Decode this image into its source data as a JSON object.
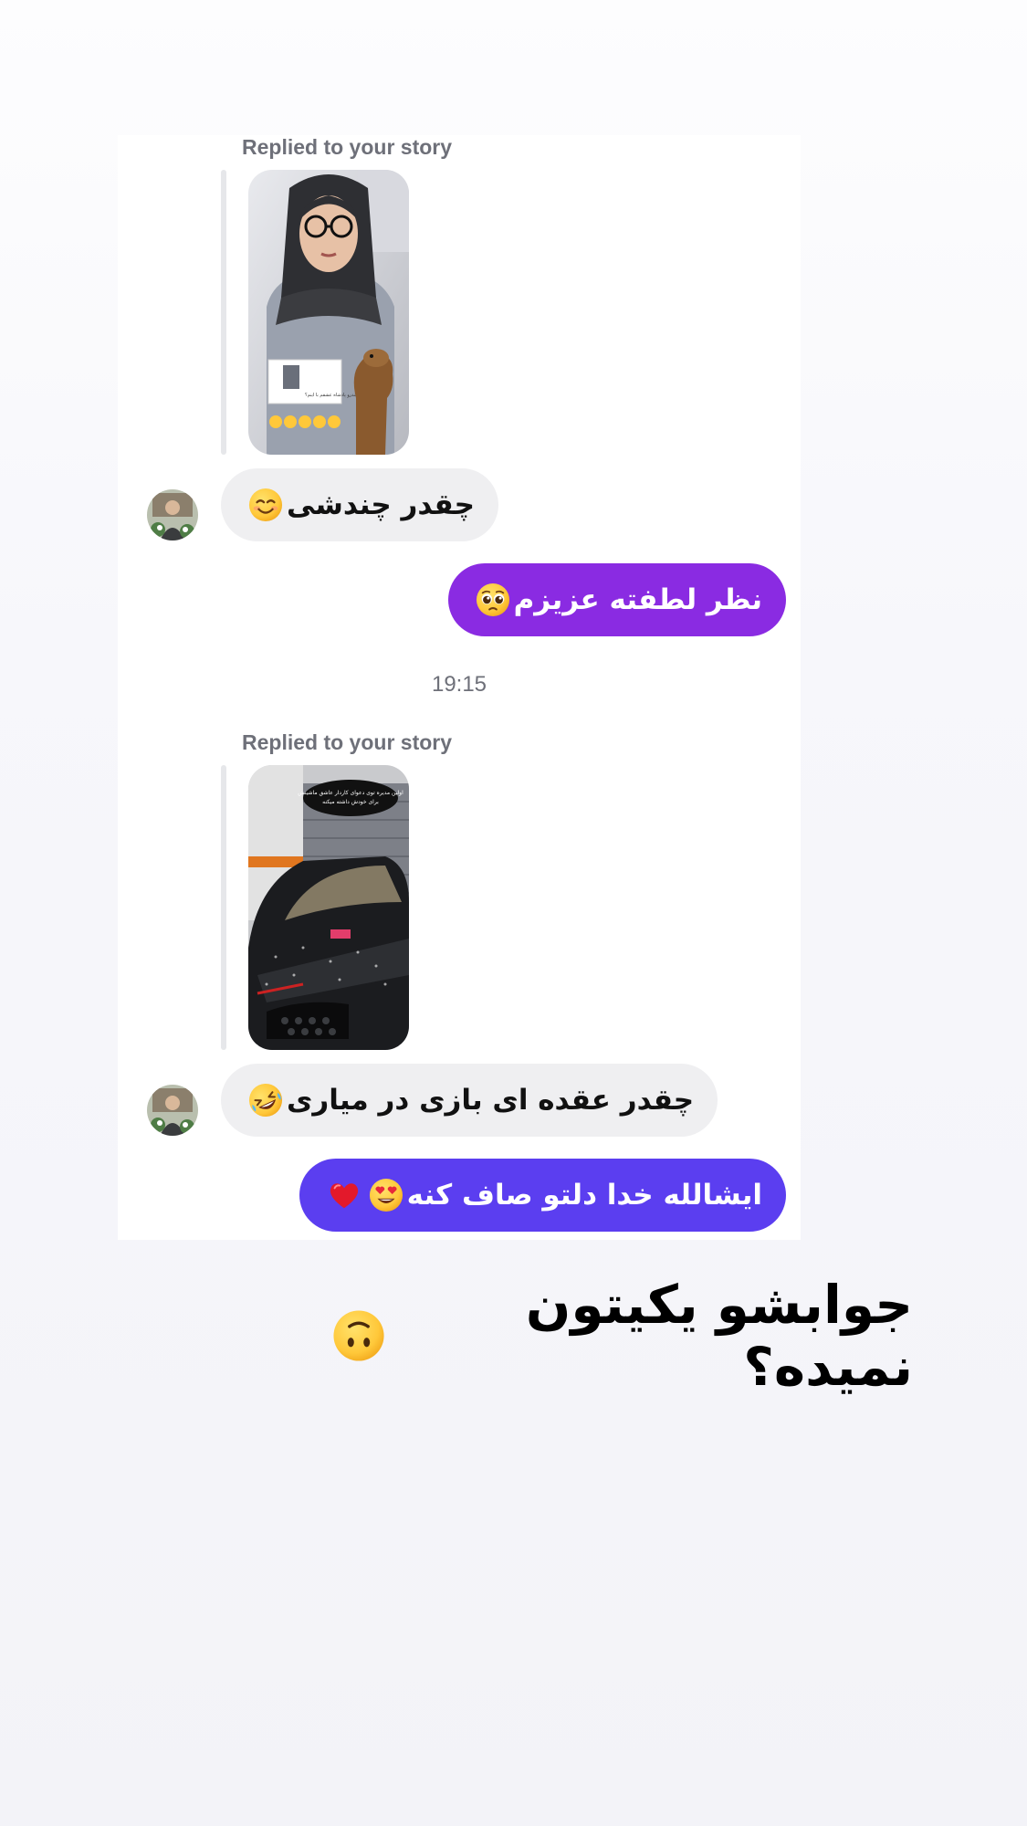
{
  "colors": {
    "incoming_bubble": "#efeff1",
    "outgoing_bubble_1": "#8a2be2",
    "outgoing_bubble_2": "#5b3ef0",
    "timestamp_text": "#6e7079"
  },
  "conversation": {
    "story_reply_1": {
      "label": "Replied to your story",
      "thumbnail": {
        "overlay_caption": "خیلی تندرو پادشاه عشقم با اینم؟",
        "emojis": "🤣🤣🤣🤣🤣"
      },
      "message": {
        "text": "چقدر چندشی",
        "emoji": "smiling-face-icon"
      }
    },
    "outgoing_1": {
      "text": "نظر لطفته عزیزم",
      "emoji": "pleading-face-icon"
    },
    "timestamp": "19:15",
    "story_reply_2": {
      "label": "Replied to your story",
      "thumbnail": {
        "overlay_caption_line1": "اولین مدیره توی دعوای کاردار عاشق ماشینش",
        "overlay_caption_line2": "برای خودش داشته میکنه"
      },
      "message": {
        "text": "چقدر عقده ای بازی در میاری",
        "emoji": "rolling-laughing-face-icon"
      }
    },
    "outgoing_2": {
      "text": "ایشالله خدا دلتو صاف کنه",
      "emojis": [
        "heart-eyes-face-icon",
        "red-heart-icon"
      ]
    }
  },
  "caption": {
    "text": "جوابشو یکیتون نمیده؟",
    "emoji": "upside-down-face-icon"
  }
}
